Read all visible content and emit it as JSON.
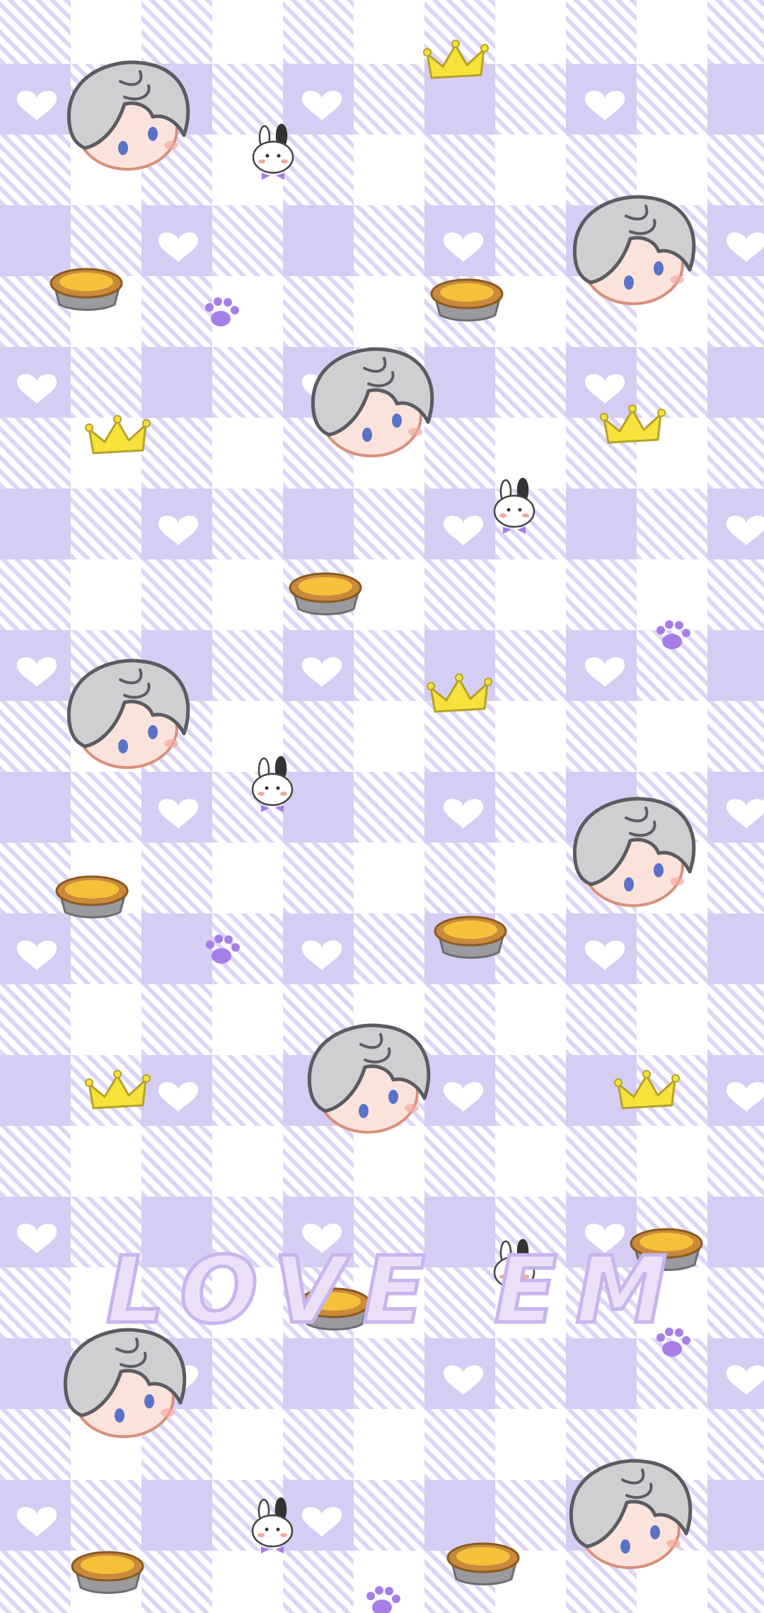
{
  "wallpaper": {
    "caption": "LOVE EM",
    "colors": {
      "checker_light": "#ddd6f6",
      "checker_dark": "#c9bdf0",
      "background": "#ffffff",
      "stripe": "#c3b6ee",
      "heart": "#ffffff",
      "caption_fill": "#ecdffa",
      "caption_stroke": "#c8b4ee",
      "hair": "#cfcfd2",
      "hair_outline": "#5b5b62",
      "skin": "#fbe3dc",
      "eye": "#5a73c8",
      "crown": "#f7e23b",
      "crown_outline": "#b4a22a",
      "tart_crust": "#c98a3c",
      "tart_filling": "#f4c23a",
      "tart_tin": "#9a9a9f",
      "paw": "#a77ee8",
      "bunny": "#ffffff",
      "bow": "#a77ee8"
    },
    "motifs": [
      "chibi-head-icon",
      "bunny-icon",
      "crown-icon",
      "egg-tart-icon",
      "paw-print-icon",
      "heart-icon"
    ]
  }
}
